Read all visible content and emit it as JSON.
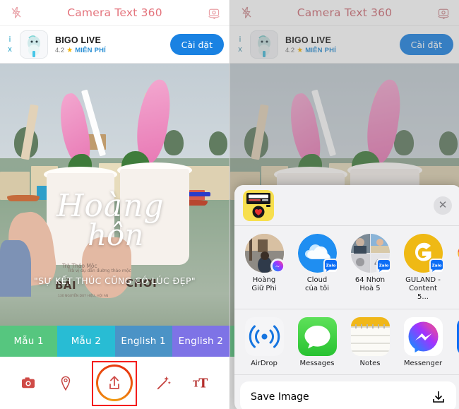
{
  "app": {
    "title": "Camera Text 360",
    "flash_icon": "flash-off-icon",
    "flip_icon": "camera-flip-icon"
  },
  "ad": {
    "info_mark": "i",
    "close_mark": "x",
    "app_name": "BIGO LIVE",
    "rating": "4.2",
    "star": "★",
    "price_label": "MIỄN PHÍ",
    "cta_label": "Cài đặt",
    "icon": "bigo-live-app-icon"
  },
  "photo": {
    "script_line1": "Hoàng",
    "script_line2": "hôn",
    "quote": "\"SỰ KẾT THÚC CŨNG CÓ LÚC ĐẸP\"",
    "cup_label": "Trà Thảo Mộc",
    "cup_sub": "Trà vị dụ dẫn đường thảo mộc",
    "cup_brand_left": "BẢI",
    "cup_brand_right": "CHƠI",
    "cup_addr": "130 NGUYỄN DUY HIỆU, HỘI AN"
  },
  "template_tabs": [
    {
      "label": "Mẫu 1",
      "color": "#56c67f"
    },
    {
      "label": "Mẫu 2",
      "color": "#28bcd4"
    },
    {
      "label": "English 1",
      "color": "#4b93c6"
    },
    {
      "label": "English 2",
      "color": "#7e73e6"
    }
  ],
  "toolbar": {
    "camera_icon": "camera-icon",
    "location_icon": "location-pin-icon",
    "share_icon": "share-upload-icon",
    "magic_icon": "magic-wand-icon",
    "text_icon": "text-tool-icon",
    "highlight_color": "#f41c1c"
  },
  "share_sheet": {
    "app_icon": "camera-text-360-app-icon",
    "close_label": "✕",
    "contacts": [
      {
        "name_line1": "Hoàng",
        "name_line2": "Giữ Phi",
        "badge": "messenger-badge"
      },
      {
        "name_line1": "Cloud",
        "name_line2": "của tôi",
        "badge": "zalo-badge"
      },
      {
        "name_line1": "64 Nhơn",
        "name_line2": "Hoà 5",
        "badge": "zalo-badge",
        "group_count": "41"
      },
      {
        "name_line1": "GULAND -",
        "name_line2": "Content 5...",
        "badge": "zalo-badge"
      },
      {
        "name_line1": "",
        "name_line2": "",
        "badge": ""
      }
    ],
    "apps": [
      {
        "name": "AirDrop",
        "icon": "airdrop-icon"
      },
      {
        "name": "Messages",
        "icon": "messages-icon"
      },
      {
        "name": "Notes",
        "icon": "notes-icon"
      },
      {
        "name": "Messenger",
        "icon": "messenger-icon"
      },
      {
        "name": "",
        "icon": "zalo-icon"
      }
    ],
    "actions": [
      {
        "label": "Save Image",
        "icon": "download-icon"
      }
    ]
  }
}
